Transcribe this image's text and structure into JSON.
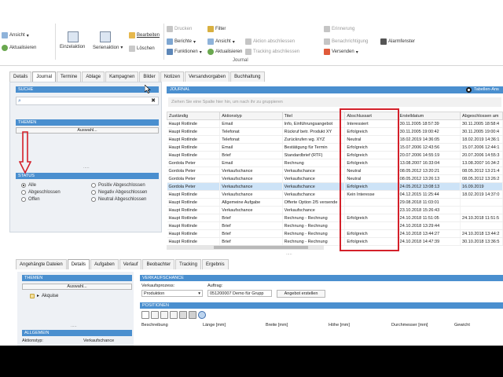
{
  "ribbon": {
    "left_items": [
      "Ansicht",
      "Aktualisieren"
    ],
    "einzelaktion": "Einzelaktion",
    "serienaktion": "Serienaktion",
    "bearbeiten": "Bearbeiten",
    "loeschen": "Löschen",
    "drucken": "Drucken",
    "berichte": "Berichte",
    "funktionen": "Funktionen",
    "filter": "Filter",
    "ansicht2": "Ansicht",
    "aktualisieren2": "Aktualisieren",
    "aktion_abschliessen": "Aktion abschliessen",
    "tracking_abschliessen": "Tracking abschliessen",
    "erinnerung": "Erinnerung",
    "benachrichtigung": "Benachrichtigung",
    "versenden": "Versenden",
    "alarmfenster": "Alarmfenster",
    "group_journal": "Journal"
  },
  "tabs": [
    "Details",
    "Journal",
    "Termine",
    "Ablage",
    "Kampagnen",
    "Bilder",
    "Notizen",
    "Versandvorgaben",
    "Buchhaltung"
  ],
  "left_panel": {
    "suche": "SUCHE",
    "themen": "THEMEN",
    "auswahl": "Auswahl...",
    "status": "STATUS",
    "radios": [
      {
        "label": "Alle",
        "on": true
      },
      {
        "label": "Abgeschlossen",
        "on": false
      },
      {
        "label": "Offen",
        "on": false
      },
      {
        "label": "Positiv Abgeschlossen",
        "on": false
      },
      {
        "label": "Negativ Abgeschlossen",
        "on": false
      },
      {
        "label": "Neutral Abgeschlossen",
        "on": false
      }
    ]
  },
  "journal": {
    "title": "JOURNAL",
    "tabellen": "Tabellen-Ans",
    "group_hint": "Ziehen Sie eine Spalte hier hin, um nach ihr zu gruppieren",
    "columns": [
      "Zuständig",
      "Aktionstyp",
      "Titel",
      "Abschlussart",
      "Erstelldatum",
      "Abgeschlossen am"
    ],
    "rows": [
      [
        "Haupt Rotlinde",
        "Email",
        "Info, Einführungsangebot",
        "Interessiert",
        "30.11.2005 18:57:39",
        "30.11.2005 18:58:4"
      ],
      [
        "Haupt Rotlinde",
        "Telefonat",
        "Rückruf betr. Produkt XY",
        "Erfolgreich",
        "30.11.2005 19:00:42",
        "30.11.2005 19:00:4"
      ],
      [
        "Haupt Rotlinde",
        "Telefonat",
        "Zurückrufen wg. XYZ",
        "Neutral",
        "18.02.2019 14:36:05",
        "18.02.2019 14:36:1"
      ],
      [
        "Haupt Rotlinde",
        "Email",
        "Bestätigung für Termin",
        "Erfolgreich",
        "15.07.2006 12:43:56",
        "15.07.2006 12:44:1"
      ],
      [
        "Haupt Rotlinde",
        "Brief",
        "Standardbrief (RTF)",
        "Erfolgreich",
        "20.07.2006 14:55:19",
        "20.07.2006 14:55:3"
      ],
      [
        "Gordola Peter",
        "Email",
        "Rechnung",
        "Erfolgreich",
        "13.08.2007 16:33:04",
        "13.08.2007 16:34:2"
      ],
      [
        "Gordola Peter",
        "Verkaufschance",
        "Verkaufschance",
        "Neutral",
        "08.05.2012 13:20:21",
        "08.05.2012 13:21:4"
      ],
      [
        "Gordola Peter",
        "Verkaufschance",
        "Verkaufschance",
        "Neutral",
        "08.05.2012 13:26:13",
        "08.05.2012 13:26:2"
      ],
      [
        "Gordola Peter",
        "Verkaufschance",
        "Verkaufschance",
        "Erfolgreich",
        "24.05.2012 13:08:13",
        "16.09.2019"
      ],
      [
        "Haupt Rotlinde",
        "Verkaufschance",
        "Verkaufschance",
        "Kein Interesse",
        "04.12.2015 11:25:44",
        "18.02.2019 14:37:0"
      ],
      [
        "Haupt Rotlinde",
        "Allgemeine Aufgabe",
        "Offerte Option 2/5 versende",
        "",
        "29.08.2018 11:03:01",
        ""
      ],
      [
        "Haupt Rotlinde",
        "Verkaufschance",
        "Verkaufschance",
        "",
        "23.10.2018 15:26:43",
        ""
      ],
      [
        "Haupt Rotlinde",
        "Brief",
        "Rechnung - Rechnung",
        "Erfolgreich",
        "24.10.2018 11:51:05",
        "24.10.2018 11:51:5"
      ],
      [
        "Haupt Rotlinde",
        "Brief",
        "Rechnung - Rechnung",
        "",
        "24.10.2018 13:29:44",
        ""
      ],
      [
        "Haupt Rotlinde",
        "Brief",
        "Rechnung - Rechnung",
        "Erfolgreich",
        "24.10.2018 13:44:27",
        "24.10.2018 13:44:2"
      ],
      [
        "Haupt Rotlinde",
        "Brief",
        "Rechnung - Rechnung",
        "Erfolgreich",
        "24.10.2018 14:47:39",
        "30.10.2018 13:36:5"
      ]
    ]
  },
  "bottom_tabs": [
    "Angehängte Dateien",
    "Details",
    "Aufgaben",
    "Verlauf",
    "Beobachter",
    "Tracking",
    "Ergebnis"
  ],
  "bottom_left": {
    "themen": "THEMEN",
    "auswahl": "Auswahl...",
    "akquise": "Akquise",
    "allgemein": "ALLGEMEIN",
    "aktionstyp_label": "Aktionstyp:",
    "aktionstyp_value": "Verkaufschance"
  },
  "bottom_right": {
    "verkaufschance": "VERKAUFSCHANCE",
    "verkaufsprozess_label": "Verkaufsprozess:",
    "verkaufsprozess_value": "Produktion",
    "auftrag_label": "Auftrag:",
    "auftrag_value": "051200007 Demo für Grupp",
    "angebot_button": "Angebot erstellen",
    "positionen": "POSITIONEN",
    "pos_columns": [
      "Beschreibung",
      "Länge [mm]",
      "Breite [mm]",
      "Höhe [mm]",
      "Durchmesser [mm]",
      "Gewicht"
    ]
  }
}
